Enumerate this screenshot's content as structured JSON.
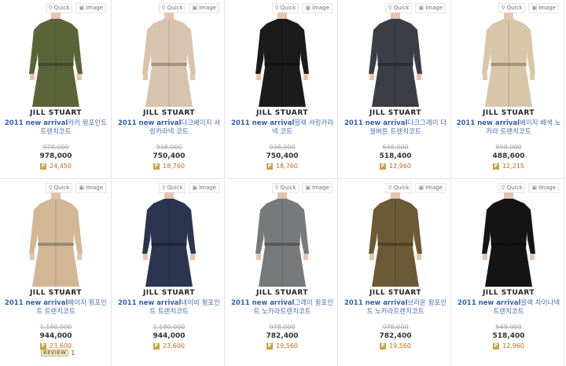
{
  "toolbar": {
    "quick_label": "Quick",
    "image_label": "Image"
  },
  "products": [
    {
      "brand": "JILL STUART",
      "name_prefix": "2011 new arrival",
      "name_rest": "카키 윙포인트 트렌치코트",
      "price_old": "978,000",
      "price": "978,000",
      "points": "24,450",
      "coat_color": "#5b6438",
      "has_review": false
    },
    {
      "brand": "JILL STUART",
      "name_prefix": "2011 new arrival",
      "name_rest": "다크베이지 셔링카라넥 코트",
      "price_old": "938,000",
      "price": "750,400",
      "points": "18,760",
      "coat_color": "#d8c3ae",
      "has_review": false
    },
    {
      "brand": "JILL STUART",
      "name_prefix": "2011 new arrival",
      "name_rest": "블랙 셔링카라넥 코트",
      "price_old": "938,000",
      "price": "750,400",
      "points": "18,760",
      "coat_color": "#1b1b1b",
      "has_review": false
    },
    {
      "brand": "JILL STUART",
      "name_prefix": "2011 new arrival",
      "name_rest": "다크그레이 더블버튼 트렌치코트",
      "price_old": "648,000",
      "price": "518,400",
      "points": "12,960",
      "coat_color": "#3c3e45",
      "has_review": false
    },
    {
      "brand": "JILL STUART",
      "name_prefix": "2011 new arrival",
      "name_rest": "베이지 배색 노카라 트렌치코트",
      "price_old": "898,000",
      "price": "488,600",
      "points": "12,215",
      "coat_color": "#d9c6a8",
      "has_review": false
    },
    {
      "brand": "JILL STUART",
      "name_prefix": "2011 new arrival",
      "name_rest": "베이지 윙포인트 트렌치코트",
      "price_old": "1,180,000",
      "price": "944,000",
      "points": "23,600",
      "coat_color": "#d2b797",
      "has_review": true,
      "review_label": "REVIEW",
      "review_count": "1"
    },
    {
      "brand": "JILL STUART",
      "name_prefix": "2011 new arrival",
      "name_rest": "네이비 윙포인트 트렌치코트",
      "price_old": "1,180,000",
      "price": "944,000",
      "points": "23,600",
      "coat_color": "#2b3550",
      "has_review": false
    },
    {
      "brand": "JILL STUART",
      "name_prefix": "2011 new arrival",
      "name_rest": "그레이 윙포인트 노카라트렌치코트",
      "price_old": "978,000",
      "price": "782,400",
      "points": "19,560",
      "coat_color": "#78797b",
      "has_review": false
    },
    {
      "brand": "JILL STUART",
      "name_prefix": "2011 new arrival",
      "name_rest": "브라운 윙포인트 노카라트렌치코트",
      "price_old": "978,000",
      "price": "782,400",
      "points": "19,560",
      "coat_color": "#6b5a35",
      "has_review": false
    },
    {
      "brand": "JILL STUART",
      "name_prefix": "2011 new arrival",
      "name_rest": "블랙 차이나넥 트렌치코트",
      "price_old": "648,000",
      "price": "518,400",
      "points": "12,960",
      "coat_color": "#141414",
      "has_review": false
    }
  ],
  "point_badge": "P",
  "colors": {
    "link": "#4b6fa8",
    "points": "#c46a22",
    "border": "#e3e3e3"
  }
}
